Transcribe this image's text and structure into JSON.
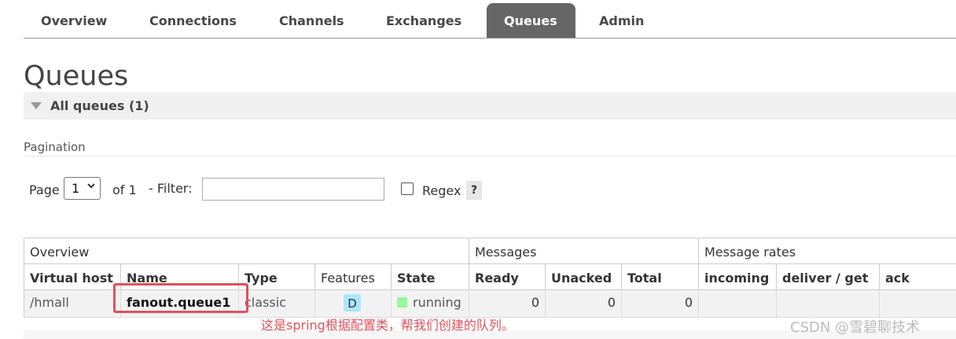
{
  "nav": {
    "tabs": [
      {
        "label": "Overview",
        "active": false
      },
      {
        "label": "Connections",
        "active": false
      },
      {
        "label": "Channels",
        "active": false
      },
      {
        "label": "Exchanges",
        "active": false
      },
      {
        "label": "Queues",
        "active": true
      },
      {
        "label": "Admin",
        "active": false
      }
    ]
  },
  "page": {
    "title": "Queues",
    "section_label": "All queues (1)"
  },
  "pagination": {
    "label": "Pagination",
    "page_word": "Page",
    "page_value": "1",
    "of_text": "of 1",
    "filter_label": "- Filter:",
    "filter_value": "",
    "regex_label": "Regex",
    "regex_checked": false,
    "help_label": "?"
  },
  "table": {
    "groups": [
      "Overview",
      "Messages",
      "Message rates"
    ],
    "headers": {
      "virtual_host": "Virtual host",
      "name": "Name",
      "type": "Type",
      "features": "Features",
      "state": "State",
      "ready": "Ready",
      "unacked": "Unacked",
      "total": "Total",
      "incoming": "incoming",
      "deliver_get": "deliver / get",
      "ack": "ack"
    },
    "rows": [
      {
        "virtual_host": "/hmall",
        "name": "fanout.queue1",
        "type": "classic",
        "features": "D",
        "state": "running",
        "ready": "0",
        "unacked": "0",
        "total": "0",
        "incoming": "",
        "deliver_get": "",
        "ack": ""
      }
    ]
  },
  "annotation": {
    "text": "这是spring根据配置类，帮我们创建的队列。",
    "color": "#e0505c"
  },
  "watermark": "CSDN @雪碧聊技术",
  "colors": {
    "active_tab": "#666666",
    "running": "#98f898",
    "durable_badge": "#aae6ff"
  }
}
